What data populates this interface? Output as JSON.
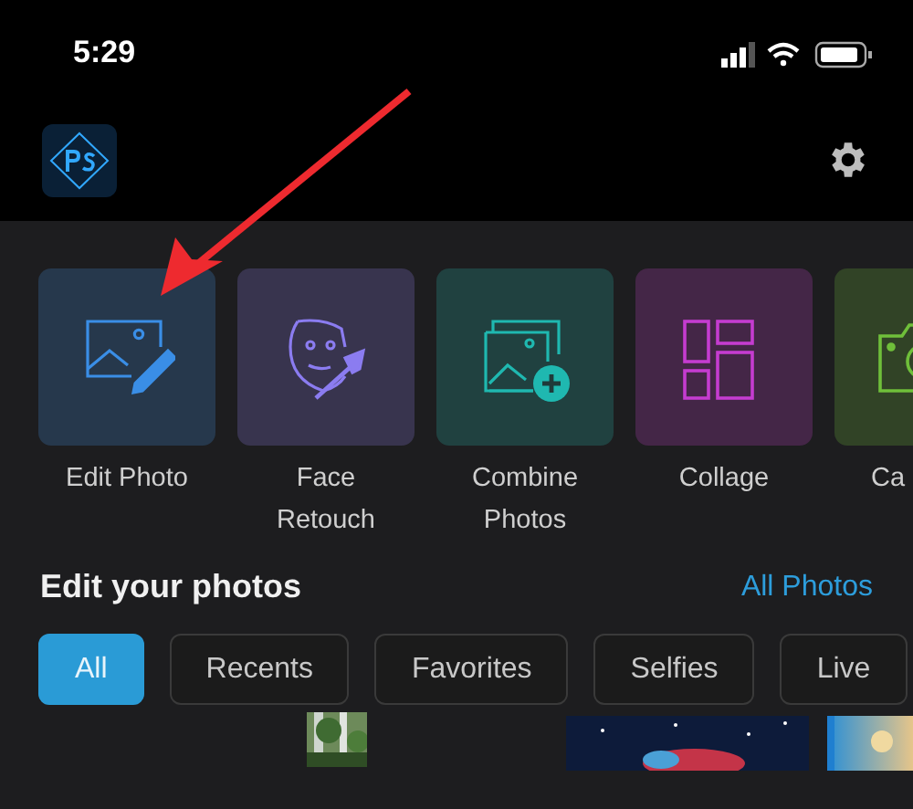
{
  "status_bar": {
    "time": "5:29"
  },
  "tools": [
    {
      "label": "Edit Photo",
      "kind": "edit",
      "color": "#3a8ee6"
    },
    {
      "label": "Face Retouch",
      "kind": "face",
      "color": "#8b7cf0"
    },
    {
      "label": "Combine Photos",
      "kind": "combine",
      "color": "#1fb8b0"
    },
    {
      "label": "Collage",
      "kind": "collage",
      "color": "#c53cd0"
    },
    {
      "label": "Ca",
      "kind": "camera",
      "color": "#6fbf3a"
    }
  ],
  "section": {
    "title": "Edit your photos",
    "link": "All Photos"
  },
  "filters": [
    {
      "label": "All",
      "selected": true
    },
    {
      "label": "Recents",
      "selected": false
    },
    {
      "label": "Favorites",
      "selected": false
    },
    {
      "label": "Selfies",
      "selected": false
    },
    {
      "label": "Live",
      "selected": false
    }
  ]
}
